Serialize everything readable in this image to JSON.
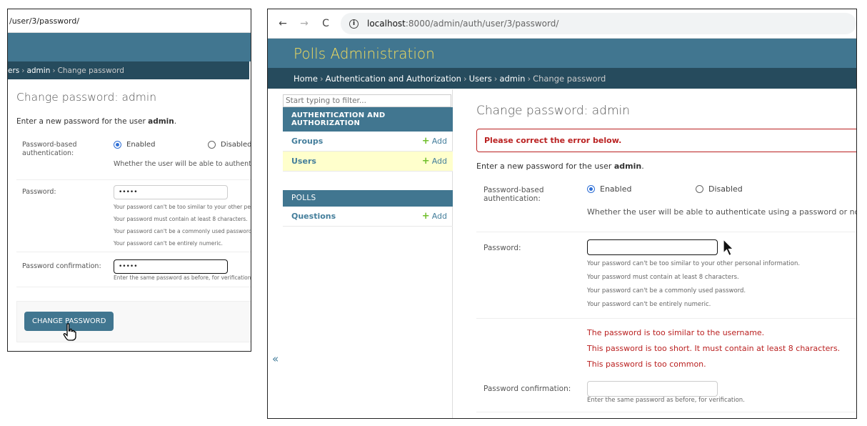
{
  "left": {
    "url_fragment": "/user/3/password/",
    "breadcrumbs": {
      "users_tail": "ers",
      "admin": "admin",
      "current": "Change password"
    },
    "title": "Change password: admin",
    "intro_prefix": "Enter a new password for the user ",
    "intro_user": "admin",
    "auth_label": "Password-based authentication:",
    "enabled_label": "Enabled",
    "disabled_label": "Disabled",
    "auth_help": "Whether the user will be able to authentica",
    "password_label": "Password:",
    "password_value": "•••••",
    "help": [
      "Your password can't be too similar to your other pe",
      "Your password must contain at least 8 characters.",
      "Your password can't be a commonly used password",
      "Your password can't be entirely numeric."
    ],
    "confirm_label": "Password confirmation:",
    "confirm_value": "•••••",
    "confirm_help": "Enter the same password as before, for verification",
    "submit_label": "CHANGE PASSWORD"
  },
  "right": {
    "browser": {
      "host": "localhost",
      "path": ":8000/admin/auth/user/3/password/"
    },
    "site_title": "Polls Administration",
    "breadcrumbs": {
      "home": "Home",
      "app": "Authentication and Authorization",
      "users": "Users",
      "admin": "admin",
      "current": "Change password"
    },
    "sidebar": {
      "filter_placeholder": "Start typing to filter...",
      "auth_caption": "AUTHENTICATION AND AUTHORIZATION",
      "groups": "Groups",
      "users": "Users",
      "polls_caption": "POLLS",
      "questions": "Questions",
      "add_label": "Add",
      "toggle": "«"
    },
    "title": "Change password: admin",
    "error_note": "Please correct the error below.",
    "intro_prefix": "Enter a new password for the user ",
    "intro_user": "admin",
    "auth_label": "Password-based authentication:",
    "enabled_label": "Enabled",
    "disabled_label": "Disabled",
    "auth_help": "Whether the user will be able to authenticate using a password or not. If di",
    "password_label": "Password:",
    "help": [
      "Your password can't be too similar to your other personal information.",
      "Your password must contain at least 8 characters.",
      "Your password can't be a commonly used password.",
      "Your password can't be entirely numeric."
    ],
    "errors": [
      "The password is too similar to the username.",
      "This password is too short. It must contain at least 8 characters.",
      "This password is too common."
    ],
    "confirm_label": "Password confirmation:",
    "confirm_help": "Enter the same password as before, for verification."
  },
  "colors": {
    "header": "#417690",
    "breadcrumbs": "#264b5d",
    "site_title": "#f5dd5d",
    "error": "#ba2121",
    "link": "#447e9b",
    "current_row": "#ffffcc"
  }
}
